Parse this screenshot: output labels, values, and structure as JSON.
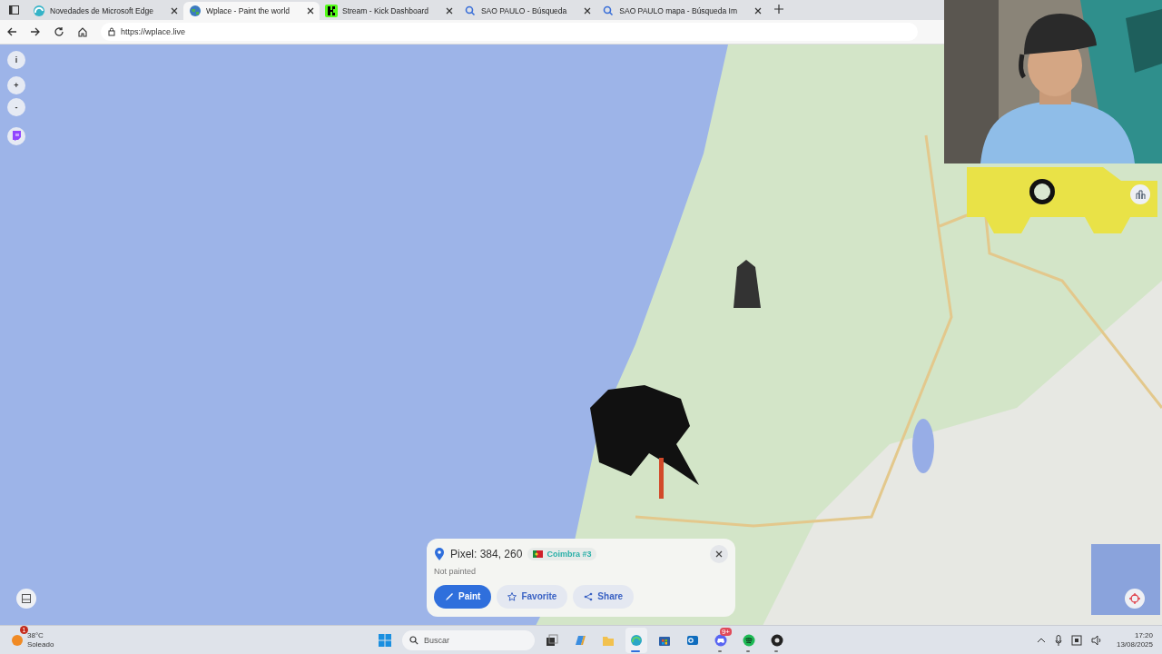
{
  "tabs": [
    {
      "title": "Novedades de Microsoft Edge",
      "kind": "edge",
      "selected": false
    },
    {
      "title": "Wplace - Paint the world",
      "kind": "globe",
      "selected": true
    },
    {
      "title": "Stream - Kick Dashboard",
      "kind": "kick",
      "selected": false
    },
    {
      "title": "SAO PAULO - Búsqueda",
      "kind": "search",
      "selected": false
    },
    {
      "title": "SAO PAULO mapa - Búsqueda Im",
      "kind": "search",
      "selected": false
    }
  ],
  "address_bar": {
    "url": "https://wplace.live"
  },
  "map": {
    "kind": "picture",
    "controls": [
      {
        "kind": "info",
        "label": "i"
      },
      {
        "kind": "zoom_in",
        "label": "+"
      },
      {
        "kind": "zoom_out",
        "label": "-"
      },
      {
        "kind": "twitch"
      }
    ]
  },
  "pixel_popup": {
    "title": "Pixel: 384, 260",
    "region": "Coimbra #3",
    "status": "Not painted",
    "actions": [
      {
        "kind": "paint",
        "label": "Paint"
      },
      {
        "kind": "favorite",
        "label": "Favorite"
      },
      {
        "kind": "share",
        "label": "Share"
      }
    ]
  },
  "taskbar": {
    "weather": {
      "temp": "38°C",
      "condition": "Soleado",
      "badge": "1"
    },
    "search": {
      "placeholder": "Buscar"
    },
    "apps": [
      {
        "kind": "taskview",
        "running": false,
        "selected": false
      },
      {
        "kind": "copilot",
        "running": false,
        "selected": false
      },
      {
        "kind": "files",
        "running": false,
        "selected": false
      },
      {
        "kind": "edge",
        "running": true,
        "selected": true
      },
      {
        "kind": "store",
        "running": false,
        "selected": false
      },
      {
        "kind": "outlook",
        "running": false,
        "selected": false
      },
      {
        "kind": "discord",
        "running": true,
        "selected": false,
        "badge": "9+"
      },
      {
        "kind": "spotify",
        "running": true,
        "selected": false
      },
      {
        "kind": "obs",
        "running": true,
        "selected": false
      }
    ],
    "clock": {
      "time": "17:20",
      "date": "13/08/2025"
    }
  }
}
